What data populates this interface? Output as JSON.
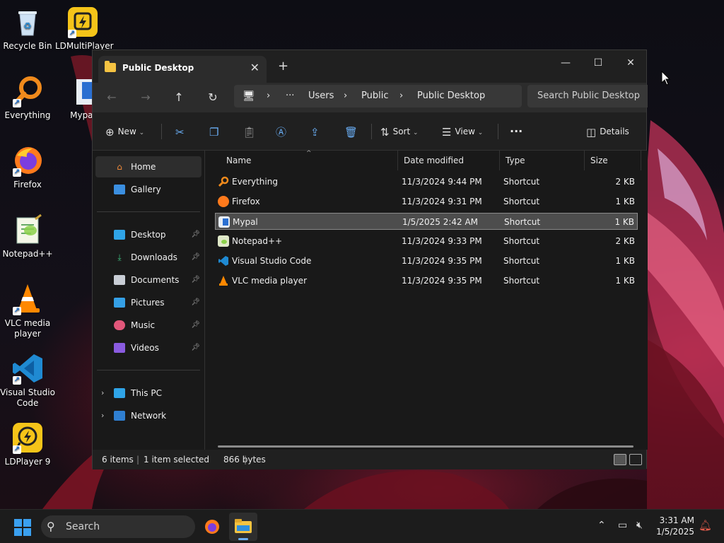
{
  "desktop": {
    "icons": [
      {
        "label": "Recycle Bin"
      },
      {
        "label": "LDMultiPlayer"
      },
      {
        "label": "Everything"
      },
      {
        "label": "Mypal"
      },
      {
        "label": "Firefox"
      },
      {
        "label": "Notepad++"
      },
      {
        "label": "VLC media player"
      },
      {
        "label": "Visual Studio Code"
      },
      {
        "label": "LDPlayer 9"
      }
    ]
  },
  "window": {
    "tab_title": "Public Desktop",
    "tab_close": "✕",
    "new_tab": "+",
    "controls": {
      "minimize": "—",
      "maximize": "☐",
      "close": "✕"
    },
    "nav": {
      "back": "←",
      "forward": "→",
      "up": "↑",
      "refresh": "↻"
    },
    "breadcrumb": {
      "pc_icon": "🖥",
      "more": "···",
      "items": [
        "Users",
        "Public",
        "Public Desktop"
      ],
      "separator": "›"
    },
    "search_placeholder": "Search Public Desktop",
    "toolbar": {
      "new_label": "New",
      "sort_label": "Sort",
      "view_label": "View",
      "more": "···",
      "details_label": "Details"
    },
    "sidebar": {
      "items": [
        {
          "label": "Home",
          "icon": "home-icon"
        },
        {
          "label": "Gallery",
          "icon": "gallery-icon"
        },
        {
          "label": "Desktop",
          "icon": "desktop-icon"
        },
        {
          "label": "Downloads",
          "icon": "downloads-icon"
        },
        {
          "label": "Documents",
          "icon": "documents-icon"
        },
        {
          "label": "Pictures",
          "icon": "pictures-icon"
        },
        {
          "label": "Music",
          "icon": "music-icon"
        },
        {
          "label": "Videos",
          "icon": "videos-icon"
        },
        {
          "label": "This PC",
          "icon": "pc-icon"
        },
        {
          "label": "Network",
          "icon": "network-icon"
        }
      ]
    },
    "columns": [
      "Name",
      "Date modified",
      "Type",
      "Size"
    ],
    "files": [
      {
        "name": "Everything",
        "date": "11/3/2024 9:44 PM",
        "type": "Shortcut",
        "size": "2 KB"
      },
      {
        "name": "Firefox",
        "date": "11/3/2024 9:31 PM",
        "type": "Shortcut",
        "size": "1 KB"
      },
      {
        "name": "Mypal",
        "date": "1/5/2025 2:42 AM",
        "type": "Shortcut",
        "size": "1 KB"
      },
      {
        "name": "Notepad++",
        "date": "11/3/2024 9:33 PM",
        "type": "Shortcut",
        "size": "2 KB"
      },
      {
        "name": "Visual Studio Code",
        "date": "11/3/2024 9:35 PM",
        "type": "Shortcut",
        "size": "1 KB"
      },
      {
        "name": "VLC media player",
        "date": "11/3/2024 9:35 PM",
        "type": "Shortcut",
        "size": "1 KB"
      }
    ],
    "status": {
      "items": "6 items",
      "selected": "1 item selected",
      "bytes": "866 bytes"
    }
  },
  "taskbar": {
    "search_label": "Search",
    "time": "3:31 AM",
    "date": "1/5/2025"
  },
  "colors": {
    "accent": "#6aaef5",
    "folder": "#f5c342",
    "selection": "#4d4d4d"
  }
}
